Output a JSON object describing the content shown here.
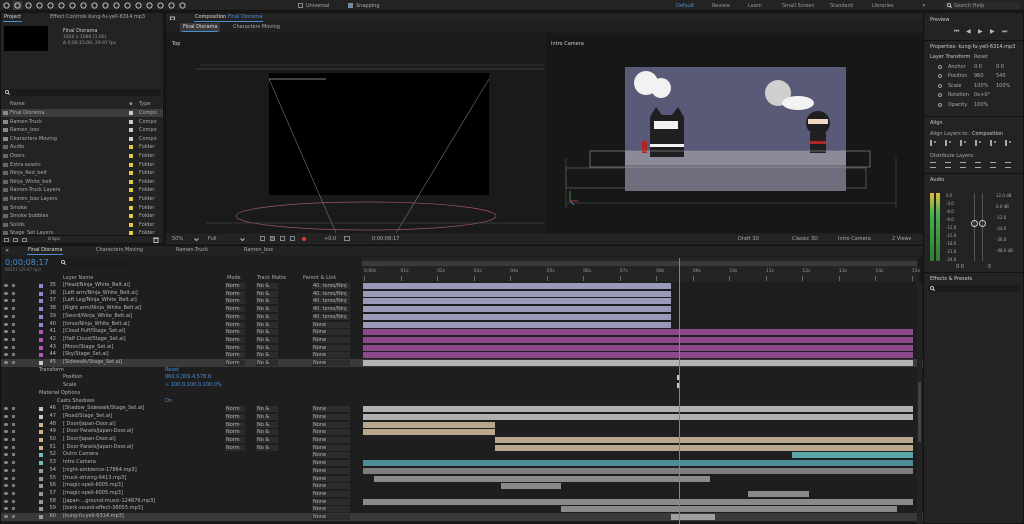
{
  "toolbar": {
    "tools": [
      "home-icon",
      "selection-tool-icon",
      "hand-tool-icon",
      "zoom-tool-icon",
      "orbit-tool-icon",
      "move-tool-icon",
      "rotate-tool-icon",
      "camera-tool-icon",
      "pan-tool-icon",
      "rectangle-tool-icon",
      "pen-tool-icon",
      "type-tool-icon",
      "brush-tool-icon",
      "clone-stamp-icon",
      "eraser-tool-icon",
      "roto-brush-icon",
      "puppet-tool-icon"
    ],
    "universal_label": "Universal",
    "snapping_label": "Snapping",
    "workspaces": [
      "Default",
      "Review",
      "Learn",
      "Small Screen",
      "Standard",
      "Libraries"
    ],
    "active_workspace": "Default",
    "search_placeholder": "Search Help"
  },
  "project": {
    "tabs": [
      "Project",
      "Effect Controls kung-fu-yell-6314.mp3"
    ],
    "selected_name": "Final Diorama",
    "selected_info": [
      "1920 x 1080 (1.00)",
      "Δ 0;00;15;00, 29.97 fps"
    ],
    "col_name": "Name",
    "col_type": "Type",
    "footer": "8 bpc",
    "items": [
      {
        "name": "Final Diorama",
        "type": "Compo",
        "color": "#c9c9c9",
        "selected": true
      },
      {
        "name": "Ramen-Truck",
        "type": "Compo",
        "color": "#c9c9c9"
      },
      {
        "name": "Ramen_box",
        "type": "Compo",
        "color": "#c9c9c9"
      },
      {
        "name": "Characters Moving",
        "type": "Compo",
        "color": "#c9c9c9"
      },
      {
        "name": "Audio",
        "type": "Folder",
        "color": "#e7c84a"
      },
      {
        "name": "Doors",
        "type": "Folder",
        "color": "#e7c84a"
      },
      {
        "name": "Extra assets",
        "type": "Folder",
        "color": "#e7c84a"
      },
      {
        "name": "Ninja_Red_belt",
        "type": "Folder",
        "color": "#e7c84a"
      },
      {
        "name": "Ninja_White_belt",
        "type": "Folder",
        "color": "#e7c84a"
      },
      {
        "name": "Ramen-Truck Layers",
        "type": "Folder",
        "color": "#e7c84a"
      },
      {
        "name": "Ramen_box Layers",
        "type": "Folder",
        "color": "#e7c84a"
      },
      {
        "name": "Smoke",
        "type": "Folder",
        "color": "#e7c84a"
      },
      {
        "name": "Smoke bubbles",
        "type": "Folder",
        "color": "#e7c84a"
      },
      {
        "name": "Solids",
        "type": "Folder",
        "color": "#e7c84a"
      },
      {
        "name": "Stage_Set Layers",
        "type": "Folder",
        "color": "#e7c84a"
      }
    ]
  },
  "composition": {
    "tab_label": "Composition",
    "comp_name": "Final Diorama",
    "subtabs": [
      "Final Diorama",
      "Characters Moving"
    ],
    "left_view": "Top",
    "right_view": "Intro Camera",
    "zoom": "50%",
    "resolution": "Full",
    "exposure": "+0.0",
    "timecode": "0;00;08;17",
    "renderer_label": "Draft 3D",
    "renderer": "Classic 3D",
    "camera": "Intro Camera",
    "views": "2 Views"
  },
  "timeline": {
    "tabs": [
      "Final Diorama",
      "Characters Moving",
      "Ramen-Truck",
      "Ramen_box"
    ],
    "timecode": "0;00;08;17",
    "frame_info": "00257 (29.97 fps)",
    "col_layer": "Layer Name",
    "col_mode": "Mode",
    "col_trackmatte": "Track Matte",
    "col_parent": "Parent & Link",
    "ruler": [
      "0;00s",
      "01s",
      "02s",
      "03s",
      "04s",
      "05s",
      "06s",
      "07s",
      "08s",
      "09s",
      "10s",
      "11s",
      "12s",
      "13s",
      "14s",
      "15s"
    ],
    "playhead_fraction": 0.574,
    "layers": [
      {
        "idx": "35",
        "name": "[Head/Ninja_White_Belt.ai]",
        "mode": "Norm",
        "trk": "No &",
        "parent": "40. torso/Ninj",
        "color": "#9a9ab8",
        "start": 0,
        "end": 0.56,
        "label": "#8c8cd2"
      },
      {
        "idx": "36",
        "name": "[Left arm/Ninja_White_Belt.ai]",
        "mode": "Norm",
        "trk": "No &",
        "parent": "40. torso/Ninj",
        "color": "#9a9ab8",
        "start": 0,
        "end": 0.56,
        "label": "#8c8cd2"
      },
      {
        "idx": "37",
        "name": "[Left Leg/Ninja_White_Belt.ai]",
        "mode": "Norm",
        "trk": "No &",
        "parent": "40. torso/Ninj",
        "color": "#9a9ab8",
        "start": 0,
        "end": 0.56,
        "label": "#8c8cd2"
      },
      {
        "idx": "38",
        "name": "[Right arm/Ninja_White_Belt.ai]",
        "mode": "Norm",
        "trk": "No &",
        "parent": "40. torso/Ninj",
        "color": "#9a9ab8",
        "start": 0,
        "end": 0.56,
        "label": "#8c8cd2"
      },
      {
        "idx": "39",
        "name": "[Sword/Ninja_White_Belt.ai]",
        "mode": "Norm",
        "trk": "No &",
        "parent": "40. torso/Ninj",
        "color": "#9a9ab8",
        "start": 0,
        "end": 0.56,
        "label": "#8c8cd2"
      },
      {
        "idx": "40",
        "name": "[torso/Ninja_White_Belt.ai]",
        "mode": "Norm",
        "trk": "No &",
        "parent": "None",
        "color": "#9a9ab8",
        "start": 0,
        "end": 0.56,
        "label": "#8c8cd2"
      },
      {
        "idx": "41",
        "name": "[Cloud Puff/Stage_Set.ai]",
        "mode": "Norm",
        "trk": "No &",
        "parent": "None",
        "color": "#8a4a8a",
        "start": 0,
        "end": 1,
        "label": "#b25ab2"
      },
      {
        "idx": "42",
        "name": "[Half Cloud/Stage_Set.ai]",
        "mode": "Norm",
        "trk": "No &",
        "parent": "None",
        "color": "#8a4a8a",
        "start": 0,
        "end": 1,
        "label": "#b25ab2"
      },
      {
        "idx": "43",
        "name": "[Moon/Stage_Set.ai]",
        "mode": "Norm",
        "trk": "No &",
        "parent": "None",
        "color": "#8a4a8a",
        "start": 0,
        "end": 1,
        "label": "#b25ab2"
      },
      {
        "idx": "44",
        "name": "[Sky/Stage_Set.ai]",
        "mode": "Norm",
        "trk": "No &",
        "parent": "None",
        "color": "#8a4a8a",
        "start": 0,
        "end": 1,
        "label": "#b25ab2"
      },
      {
        "idx": "45",
        "name": "[Sidewalk/Stage_Set.ai]",
        "mode": "Norm",
        "trk": "No &",
        "parent": "None",
        "color": "#b3b3b3",
        "start": 0,
        "end": 1,
        "label": "#c9c9c9",
        "selected": true
      },
      {
        "idx": "46",
        "name": "[Shadow_Sidewalk/Stage_Set.ai]",
        "mode": "Norm",
        "trk": "No &",
        "parent": "None",
        "color": "#b0b0b0",
        "start": 0,
        "end": 1,
        "label": "#c9c9c9",
        "row": "b"
      },
      {
        "idx": "47",
        "name": "[Road/Stage_Set.ai]",
        "mode": "Norm",
        "trk": "No &",
        "parent": "None",
        "color": "#b0b0b0",
        "start": 0,
        "end": 1,
        "label": "#c9c9c9",
        "row": "b"
      },
      {
        "idx": "48",
        "name": "[ Door/Japan-Door.ai]",
        "mode": "Norm",
        "trk": "No &",
        "parent": "None",
        "color": "#b8a78e",
        "start": 0,
        "end": 0.24,
        "label": "#d2b48c",
        "row": "b"
      },
      {
        "idx": "49",
        "name": "[ Door Panels/Japan-Door.ai]",
        "mode": "Norm",
        "trk": "No &",
        "parent": "None",
        "color": "#b8a78e",
        "start": 0,
        "end": 0.24,
        "label": "#d2b48c",
        "row": "b"
      },
      {
        "idx": "50",
        "name": "[ Door/Japan-Door.ai]",
        "mode": "Norm",
        "trk": "No &",
        "parent": "None",
        "color": "#b8a78e",
        "start": 0.24,
        "end": 1,
        "label": "#d2b48c",
        "row": "b"
      },
      {
        "idx": "51",
        "name": "[ Door Panels/Japan-Door.ai]",
        "mode": "Norm",
        "trk": "No &",
        "parent": "None",
        "color": "#b8a78e",
        "start": 0.24,
        "end": 1,
        "label": "#d2b48c",
        "row": "b"
      },
      {
        "idx": "52",
        "name": "Outro Camera",
        "mode": "",
        "trk": "",
        "parent": "None",
        "color": "#5aa6a6",
        "start": 0.78,
        "end": 1,
        "label": "#6ec1c1",
        "row": "b"
      },
      {
        "idx": "53",
        "name": "Intro Camera",
        "mode": "",
        "trk": "",
        "parent": "None",
        "color": "#4d8d95",
        "start": 0,
        "end": 1,
        "label": "#6ec1c1",
        "row": "b"
      },
      {
        "idx": "54",
        "name": "[night-ambience-17864.mp3]",
        "mode": "",
        "trk": "",
        "parent": "None",
        "color": "#7d7d7d",
        "start": 0,
        "end": 1,
        "label": "#9a9a9a",
        "row": "b"
      },
      {
        "idx": "55",
        "name": "[truck-driving-6413.mp3]",
        "mode": "",
        "trk": "",
        "parent": "None",
        "color": "#8a8a8a",
        "start": 0.02,
        "end": 0.63,
        "label": "#9a9a9a",
        "row": "b"
      },
      {
        "idx": "56",
        "name": "[magic-spell-6005.mp3]",
        "mode": "",
        "trk": "",
        "parent": "None",
        "color": "#8a8a8a",
        "start": 0.25,
        "end": 0.36,
        "label": "#9a9a9a",
        "row": "b"
      },
      {
        "idx": "57",
        "name": "[magic-spell-6005.mp3]",
        "mode": "",
        "trk": "",
        "parent": "None",
        "color": "#8a8a8a",
        "start": 0.7,
        "end": 0.81,
        "label": "#9a9a9a",
        "row": "b"
      },
      {
        "idx": "58",
        "name": "[japan-...ground-music-124876.mp3]",
        "mode": "",
        "trk": "",
        "parent": "None",
        "color": "#8a8a8a",
        "start": 0,
        "end": 1,
        "label": "#9a9a9a",
        "row": "b"
      },
      {
        "idx": "59",
        "name": "[bonk-sound-effect-36055.mp3]",
        "mode": "",
        "trk": "",
        "parent": "None",
        "color": "#8a8a8a",
        "start": 0.36,
        "end": 0.97,
        "label": "#9a9a9a",
        "row": "b"
      },
      {
        "idx": "60",
        "name": "[kung-fu-yell-6314.mp3]",
        "mode": "",
        "trk": "",
        "parent": "None",
        "color": "#a0a0a0",
        "start": 0.56,
        "end": 0.64,
        "label": "#9a9a9a",
        "row": "b",
        "selected": true
      }
    ],
    "transform": {
      "label": "Transform",
      "reset": "Reset",
      "position_label": "Position",
      "position_value": "960.0,309.4,578.6",
      "scale_label": "Scale",
      "scale_value": "∞ 100.0,100.0,100.0%"
    },
    "material": {
      "label": "Material Options",
      "casts_label": "Casts Shadows",
      "casts_value": "On"
    }
  },
  "preview": {
    "title": "Preview"
  },
  "properties": {
    "title": "Properties: kung-fu-yell-6314.mp3",
    "section": "Layer Transform",
    "reset": "Reset",
    "rows": [
      {
        "label": "Anchor",
        "v1": "0.0",
        "v2": "0.0"
      },
      {
        "label": "Position",
        "v1": "960",
        "v2": "540"
      },
      {
        "label": "Scale",
        "v1": "100%",
        "v2": "100%"
      },
      {
        "label": "Rotation",
        "v1": "0x+0°",
        "v2": ""
      },
      {
        "label": "Opacity",
        "v1": "100%",
        "v2": ""
      }
    ]
  },
  "align": {
    "title": "Align",
    "align_to_label": "Align Layers to:",
    "align_to_value": "Composition",
    "distribute_label": "Distribute Layers:"
  },
  "audio": {
    "title": "Audio",
    "left_scale": [
      "0.0",
      "-3.0",
      "-6.0",
      "-9.0",
      "-12.0",
      "-15.0",
      "-18.0",
      "-21.0",
      "-24.0"
    ],
    "right_scale": [
      "12.0 dB",
      "0.0 dB",
      "-12.0",
      "-24.0",
      "-36.0",
      "-48.0 dB"
    ],
    "bottom": [
      "0.0",
      "-3"
    ]
  },
  "effects": {
    "title": "Effects & Presets",
    "search_placeholder": ""
  }
}
